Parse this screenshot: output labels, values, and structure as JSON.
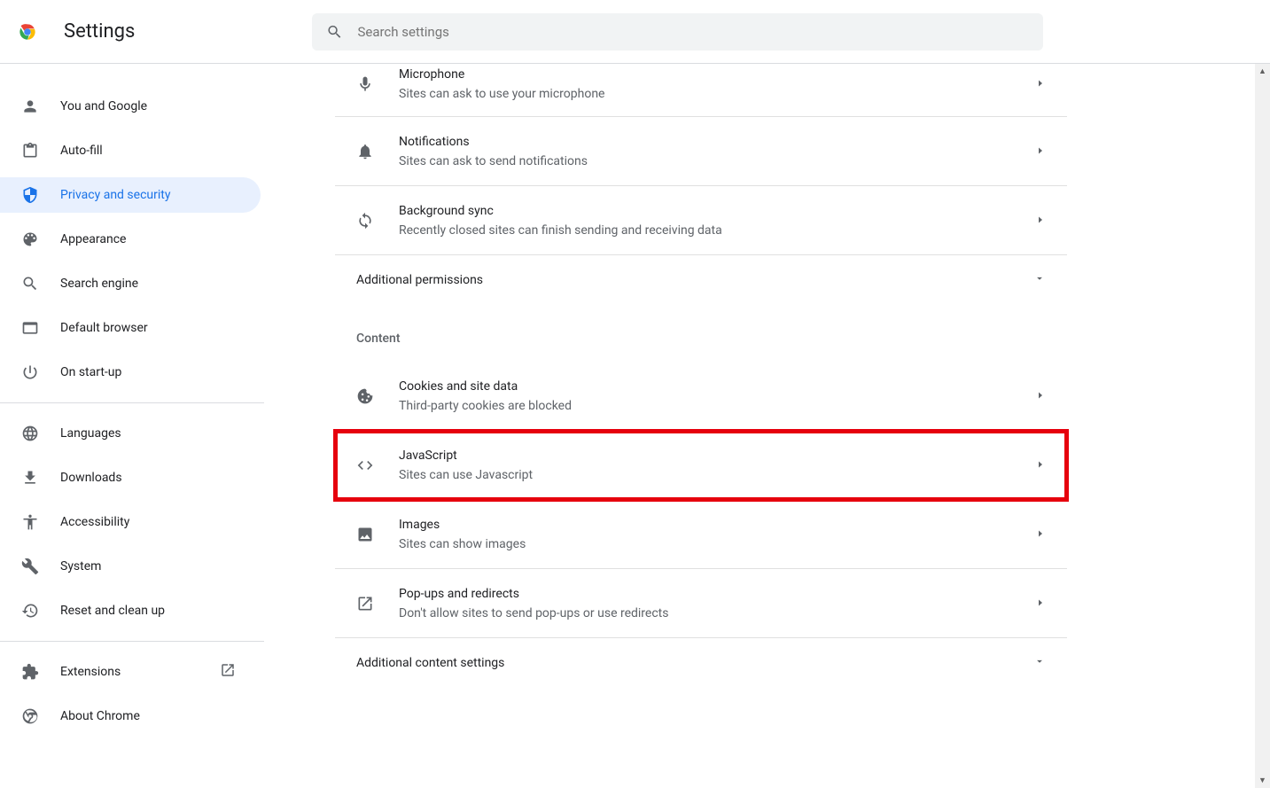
{
  "header": {
    "title": "Settings",
    "search_placeholder": "Search settings"
  },
  "sidebar": {
    "items": [
      {
        "label": "You and Google"
      },
      {
        "label": "Auto-fill"
      },
      {
        "label": "Privacy and security"
      },
      {
        "label": "Appearance"
      },
      {
        "label": "Search engine"
      },
      {
        "label": "Default browser"
      },
      {
        "label": "On start-up"
      }
    ],
    "items2": [
      {
        "label": "Languages"
      },
      {
        "label": "Downloads"
      },
      {
        "label": "Accessibility"
      },
      {
        "label": "System"
      },
      {
        "label": "Reset and clean up"
      }
    ],
    "items3": [
      {
        "label": "Extensions"
      },
      {
        "label": "About Chrome"
      }
    ]
  },
  "permissions": [
    {
      "title": "Microphone",
      "sub": "Sites can ask to use your microphone",
      "icon": "mic"
    },
    {
      "title": "Notifications",
      "sub": "Sites can ask to send notifications",
      "icon": "bell"
    },
    {
      "title": "Background sync",
      "sub": "Recently closed sites can finish sending and receiving data",
      "icon": "sync"
    }
  ],
  "additional_permissions_label": "Additional permissions",
  "content_label": "Content",
  "content_items": [
    {
      "title": "Cookies and site data",
      "sub": "Third-party cookies are blocked",
      "icon": "cookie"
    },
    {
      "title": "JavaScript",
      "sub": "Sites can use Javascript",
      "icon": "code"
    },
    {
      "title": "Images",
      "sub": "Sites can show images",
      "icon": "image"
    },
    {
      "title": "Pop-ups and redirects",
      "sub": "Don't allow sites to send pop-ups or use redirects",
      "icon": "launch"
    }
  ],
  "additional_content_label": "Additional content settings"
}
